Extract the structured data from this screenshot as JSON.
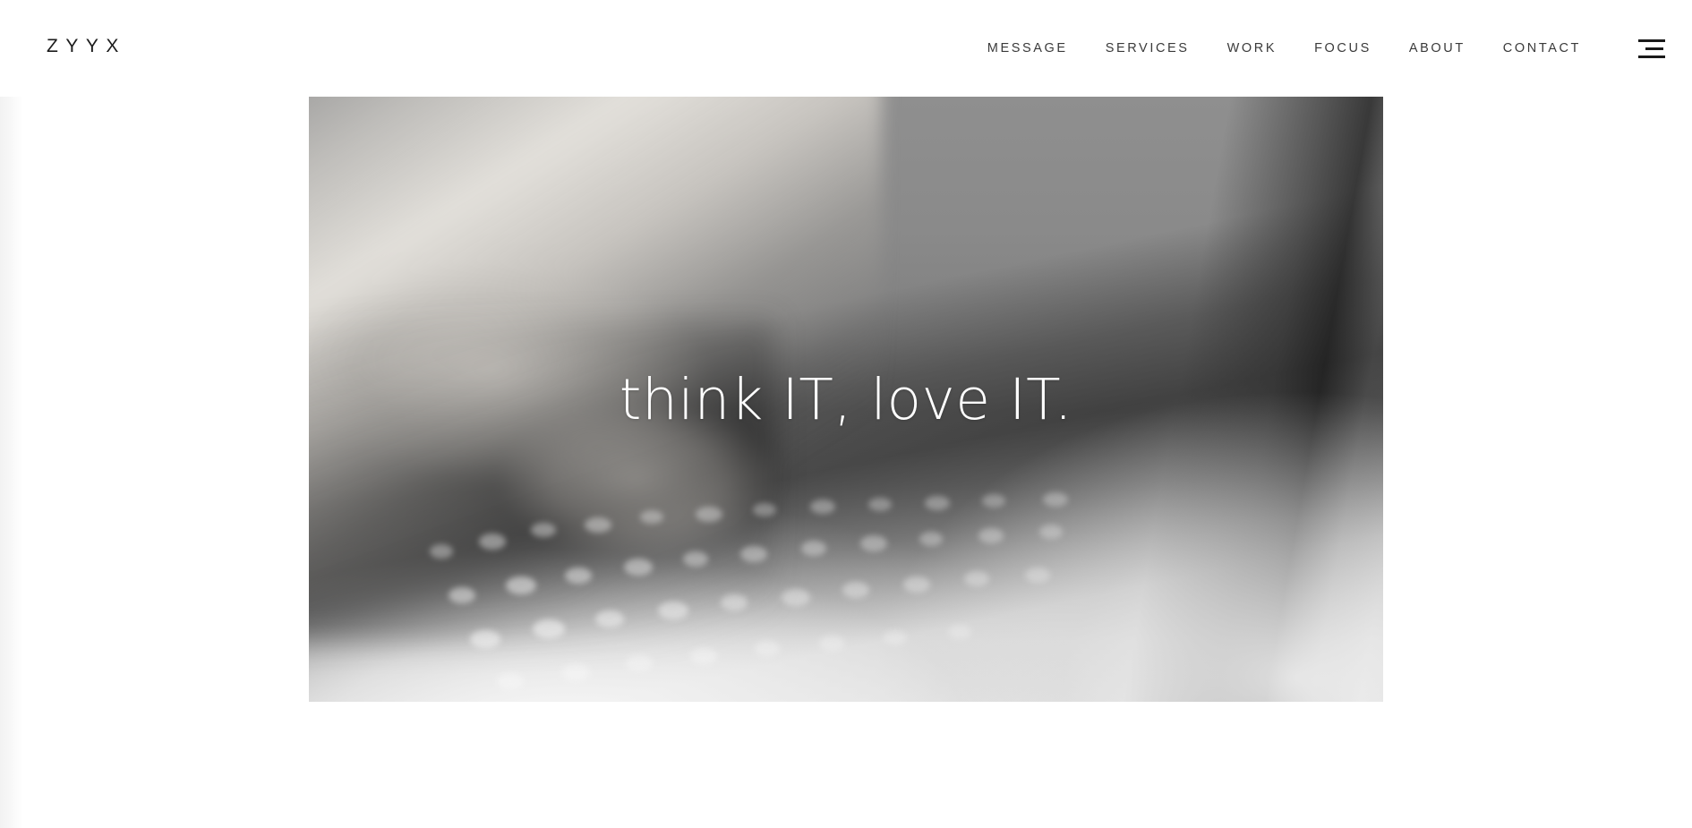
{
  "header": {
    "brand": "ZYYX",
    "nav": [
      {
        "label": "MESSAGE"
      },
      {
        "label": "SERVICES"
      },
      {
        "label": "WORK"
      },
      {
        "label": "FOCUS"
      },
      {
        "label": "ABOUT"
      },
      {
        "label": "CONTACT"
      }
    ],
    "menu_toggle_icon": "hamburger-menu-icon",
    "background_color": "#ffffff",
    "text_color": "#3a3a3a"
  },
  "hero": {
    "headline": "think IT, love IT.",
    "headline_color": "#ffffff",
    "image_alt": "cat-paw-on-laptop-keyboard",
    "image_style": "grayscale-photograph"
  },
  "page": {
    "background_color": "#ffffff"
  }
}
